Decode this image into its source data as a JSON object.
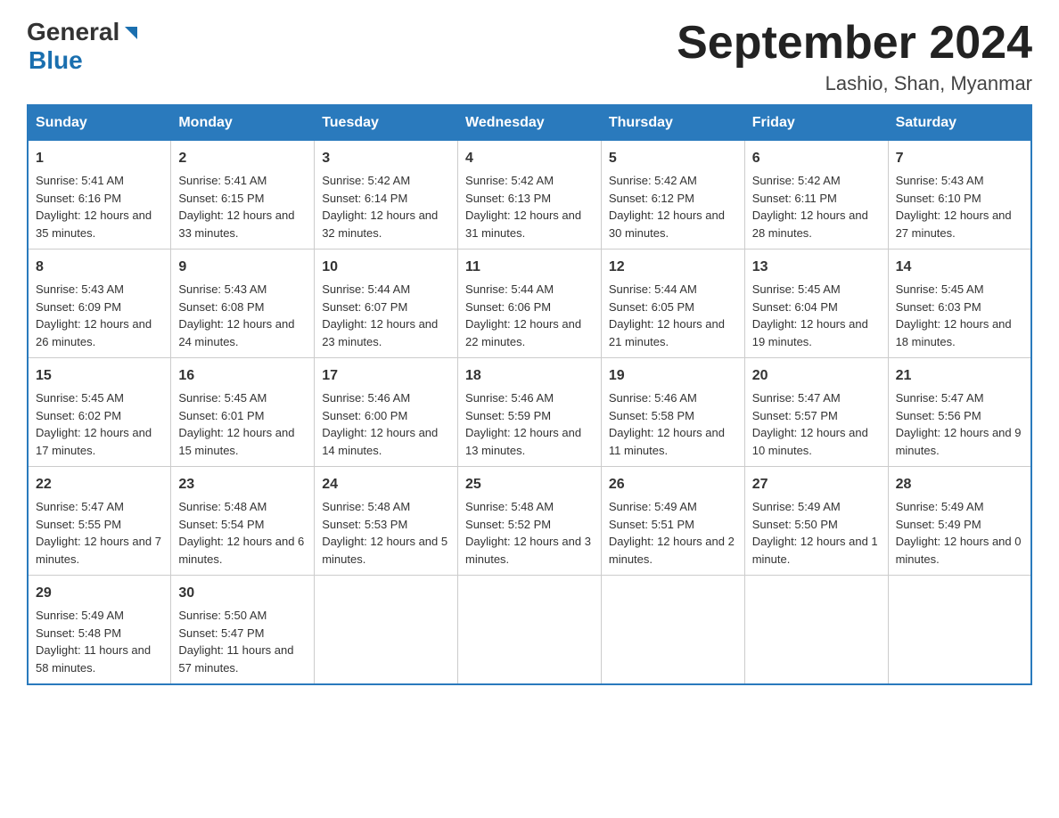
{
  "header": {
    "logo_general": "General",
    "logo_blue": "Blue",
    "title": "September 2024",
    "subtitle": "Lashio, Shan, Myanmar"
  },
  "weekdays": [
    "Sunday",
    "Monday",
    "Tuesday",
    "Wednesday",
    "Thursday",
    "Friday",
    "Saturday"
  ],
  "weeks": [
    [
      {
        "day": "1",
        "sunrise": "5:41 AM",
        "sunset": "6:16 PM",
        "daylight": "12 hours and 35 minutes."
      },
      {
        "day": "2",
        "sunrise": "5:41 AM",
        "sunset": "6:15 PM",
        "daylight": "12 hours and 33 minutes."
      },
      {
        "day": "3",
        "sunrise": "5:42 AM",
        "sunset": "6:14 PM",
        "daylight": "12 hours and 32 minutes."
      },
      {
        "day": "4",
        "sunrise": "5:42 AM",
        "sunset": "6:13 PM",
        "daylight": "12 hours and 31 minutes."
      },
      {
        "day": "5",
        "sunrise": "5:42 AM",
        "sunset": "6:12 PM",
        "daylight": "12 hours and 30 minutes."
      },
      {
        "day": "6",
        "sunrise": "5:42 AM",
        "sunset": "6:11 PM",
        "daylight": "12 hours and 28 minutes."
      },
      {
        "day": "7",
        "sunrise": "5:43 AM",
        "sunset": "6:10 PM",
        "daylight": "12 hours and 27 minutes."
      }
    ],
    [
      {
        "day": "8",
        "sunrise": "5:43 AM",
        "sunset": "6:09 PM",
        "daylight": "12 hours and 26 minutes."
      },
      {
        "day": "9",
        "sunrise": "5:43 AM",
        "sunset": "6:08 PM",
        "daylight": "12 hours and 24 minutes."
      },
      {
        "day": "10",
        "sunrise": "5:44 AM",
        "sunset": "6:07 PM",
        "daylight": "12 hours and 23 minutes."
      },
      {
        "day": "11",
        "sunrise": "5:44 AM",
        "sunset": "6:06 PM",
        "daylight": "12 hours and 22 minutes."
      },
      {
        "day": "12",
        "sunrise": "5:44 AM",
        "sunset": "6:05 PM",
        "daylight": "12 hours and 21 minutes."
      },
      {
        "day": "13",
        "sunrise": "5:45 AM",
        "sunset": "6:04 PM",
        "daylight": "12 hours and 19 minutes."
      },
      {
        "day": "14",
        "sunrise": "5:45 AM",
        "sunset": "6:03 PM",
        "daylight": "12 hours and 18 minutes."
      }
    ],
    [
      {
        "day": "15",
        "sunrise": "5:45 AM",
        "sunset": "6:02 PM",
        "daylight": "12 hours and 17 minutes."
      },
      {
        "day": "16",
        "sunrise": "5:45 AM",
        "sunset": "6:01 PM",
        "daylight": "12 hours and 15 minutes."
      },
      {
        "day": "17",
        "sunrise": "5:46 AM",
        "sunset": "6:00 PM",
        "daylight": "12 hours and 14 minutes."
      },
      {
        "day": "18",
        "sunrise": "5:46 AM",
        "sunset": "5:59 PM",
        "daylight": "12 hours and 13 minutes."
      },
      {
        "day": "19",
        "sunrise": "5:46 AM",
        "sunset": "5:58 PM",
        "daylight": "12 hours and 11 minutes."
      },
      {
        "day": "20",
        "sunrise": "5:47 AM",
        "sunset": "5:57 PM",
        "daylight": "12 hours and 10 minutes."
      },
      {
        "day": "21",
        "sunrise": "5:47 AM",
        "sunset": "5:56 PM",
        "daylight": "12 hours and 9 minutes."
      }
    ],
    [
      {
        "day": "22",
        "sunrise": "5:47 AM",
        "sunset": "5:55 PM",
        "daylight": "12 hours and 7 minutes."
      },
      {
        "day": "23",
        "sunrise": "5:48 AM",
        "sunset": "5:54 PM",
        "daylight": "12 hours and 6 minutes."
      },
      {
        "day": "24",
        "sunrise": "5:48 AM",
        "sunset": "5:53 PM",
        "daylight": "12 hours and 5 minutes."
      },
      {
        "day": "25",
        "sunrise": "5:48 AM",
        "sunset": "5:52 PM",
        "daylight": "12 hours and 3 minutes."
      },
      {
        "day": "26",
        "sunrise": "5:49 AM",
        "sunset": "5:51 PM",
        "daylight": "12 hours and 2 minutes."
      },
      {
        "day": "27",
        "sunrise": "5:49 AM",
        "sunset": "5:50 PM",
        "daylight": "12 hours and 1 minute."
      },
      {
        "day": "28",
        "sunrise": "5:49 AM",
        "sunset": "5:49 PM",
        "daylight": "12 hours and 0 minutes."
      }
    ],
    [
      {
        "day": "29",
        "sunrise": "5:49 AM",
        "sunset": "5:48 PM",
        "daylight": "11 hours and 58 minutes."
      },
      {
        "day": "30",
        "sunrise": "5:50 AM",
        "sunset": "5:47 PM",
        "daylight": "11 hours and 57 minutes."
      },
      null,
      null,
      null,
      null,
      null
    ]
  ],
  "labels": {
    "sunrise": "Sunrise:",
    "sunset": "Sunset:",
    "daylight": "Daylight:"
  }
}
